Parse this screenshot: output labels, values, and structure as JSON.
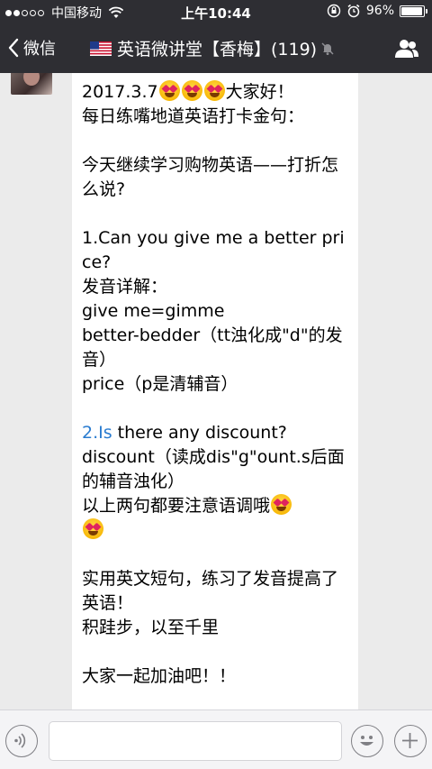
{
  "status_bar": {
    "carrier": "中国移动",
    "time": "上午10:44",
    "battery_percent": "96%",
    "battery_level": 0.96,
    "signal_bars_filled": 2,
    "signal_bars_total": 5
  },
  "nav": {
    "back_label": "微信",
    "title": "英语微讲堂【香梅】(119)"
  },
  "message": {
    "lines": {
      "l1_text": "2017.3.7",
      "l1_tail": "大家好！",
      "l2": "每日练嘴地道英语打卡金句：",
      "l3": "今天继续学习购物英语——打折怎么说?",
      "l4": "1.Can you give me a better price?",
      "l5": "发音详解：",
      "l6": "give me=gimme",
      "l7": "better-bedder（tt浊化成\"d\"的发音）",
      "l8": "price（p是清辅音）",
      "l9_link": "2.Is",
      "l9_rest": " there any discount?",
      "l10": "discount（读成dis\"g\"ount.s后面的辅音浊化）",
      "l11": "以上两句都要注意语调哦",
      "l12": "实用英文短句，练习了发音提高了英语！",
      "l13": "积跬步，以至千里",
      "l14": "大家一起加油吧！！"
    }
  },
  "colors": {
    "header_bg": "#2e2e33",
    "chat_bg": "#ebebeb",
    "link": "#2a7cd0"
  },
  "icons": {
    "wifi": "wifi-icon",
    "lock_rotation": "rotation-lock-icon",
    "alarm": "alarm-icon",
    "battery": "battery-icon",
    "back": "chevron-left-icon",
    "flag": "us-flag-icon",
    "mute": "mute-icon",
    "group": "group-members-icon",
    "voice": "voice-icon",
    "emoji": "emoji-icon",
    "plus": "plus-icon"
  }
}
